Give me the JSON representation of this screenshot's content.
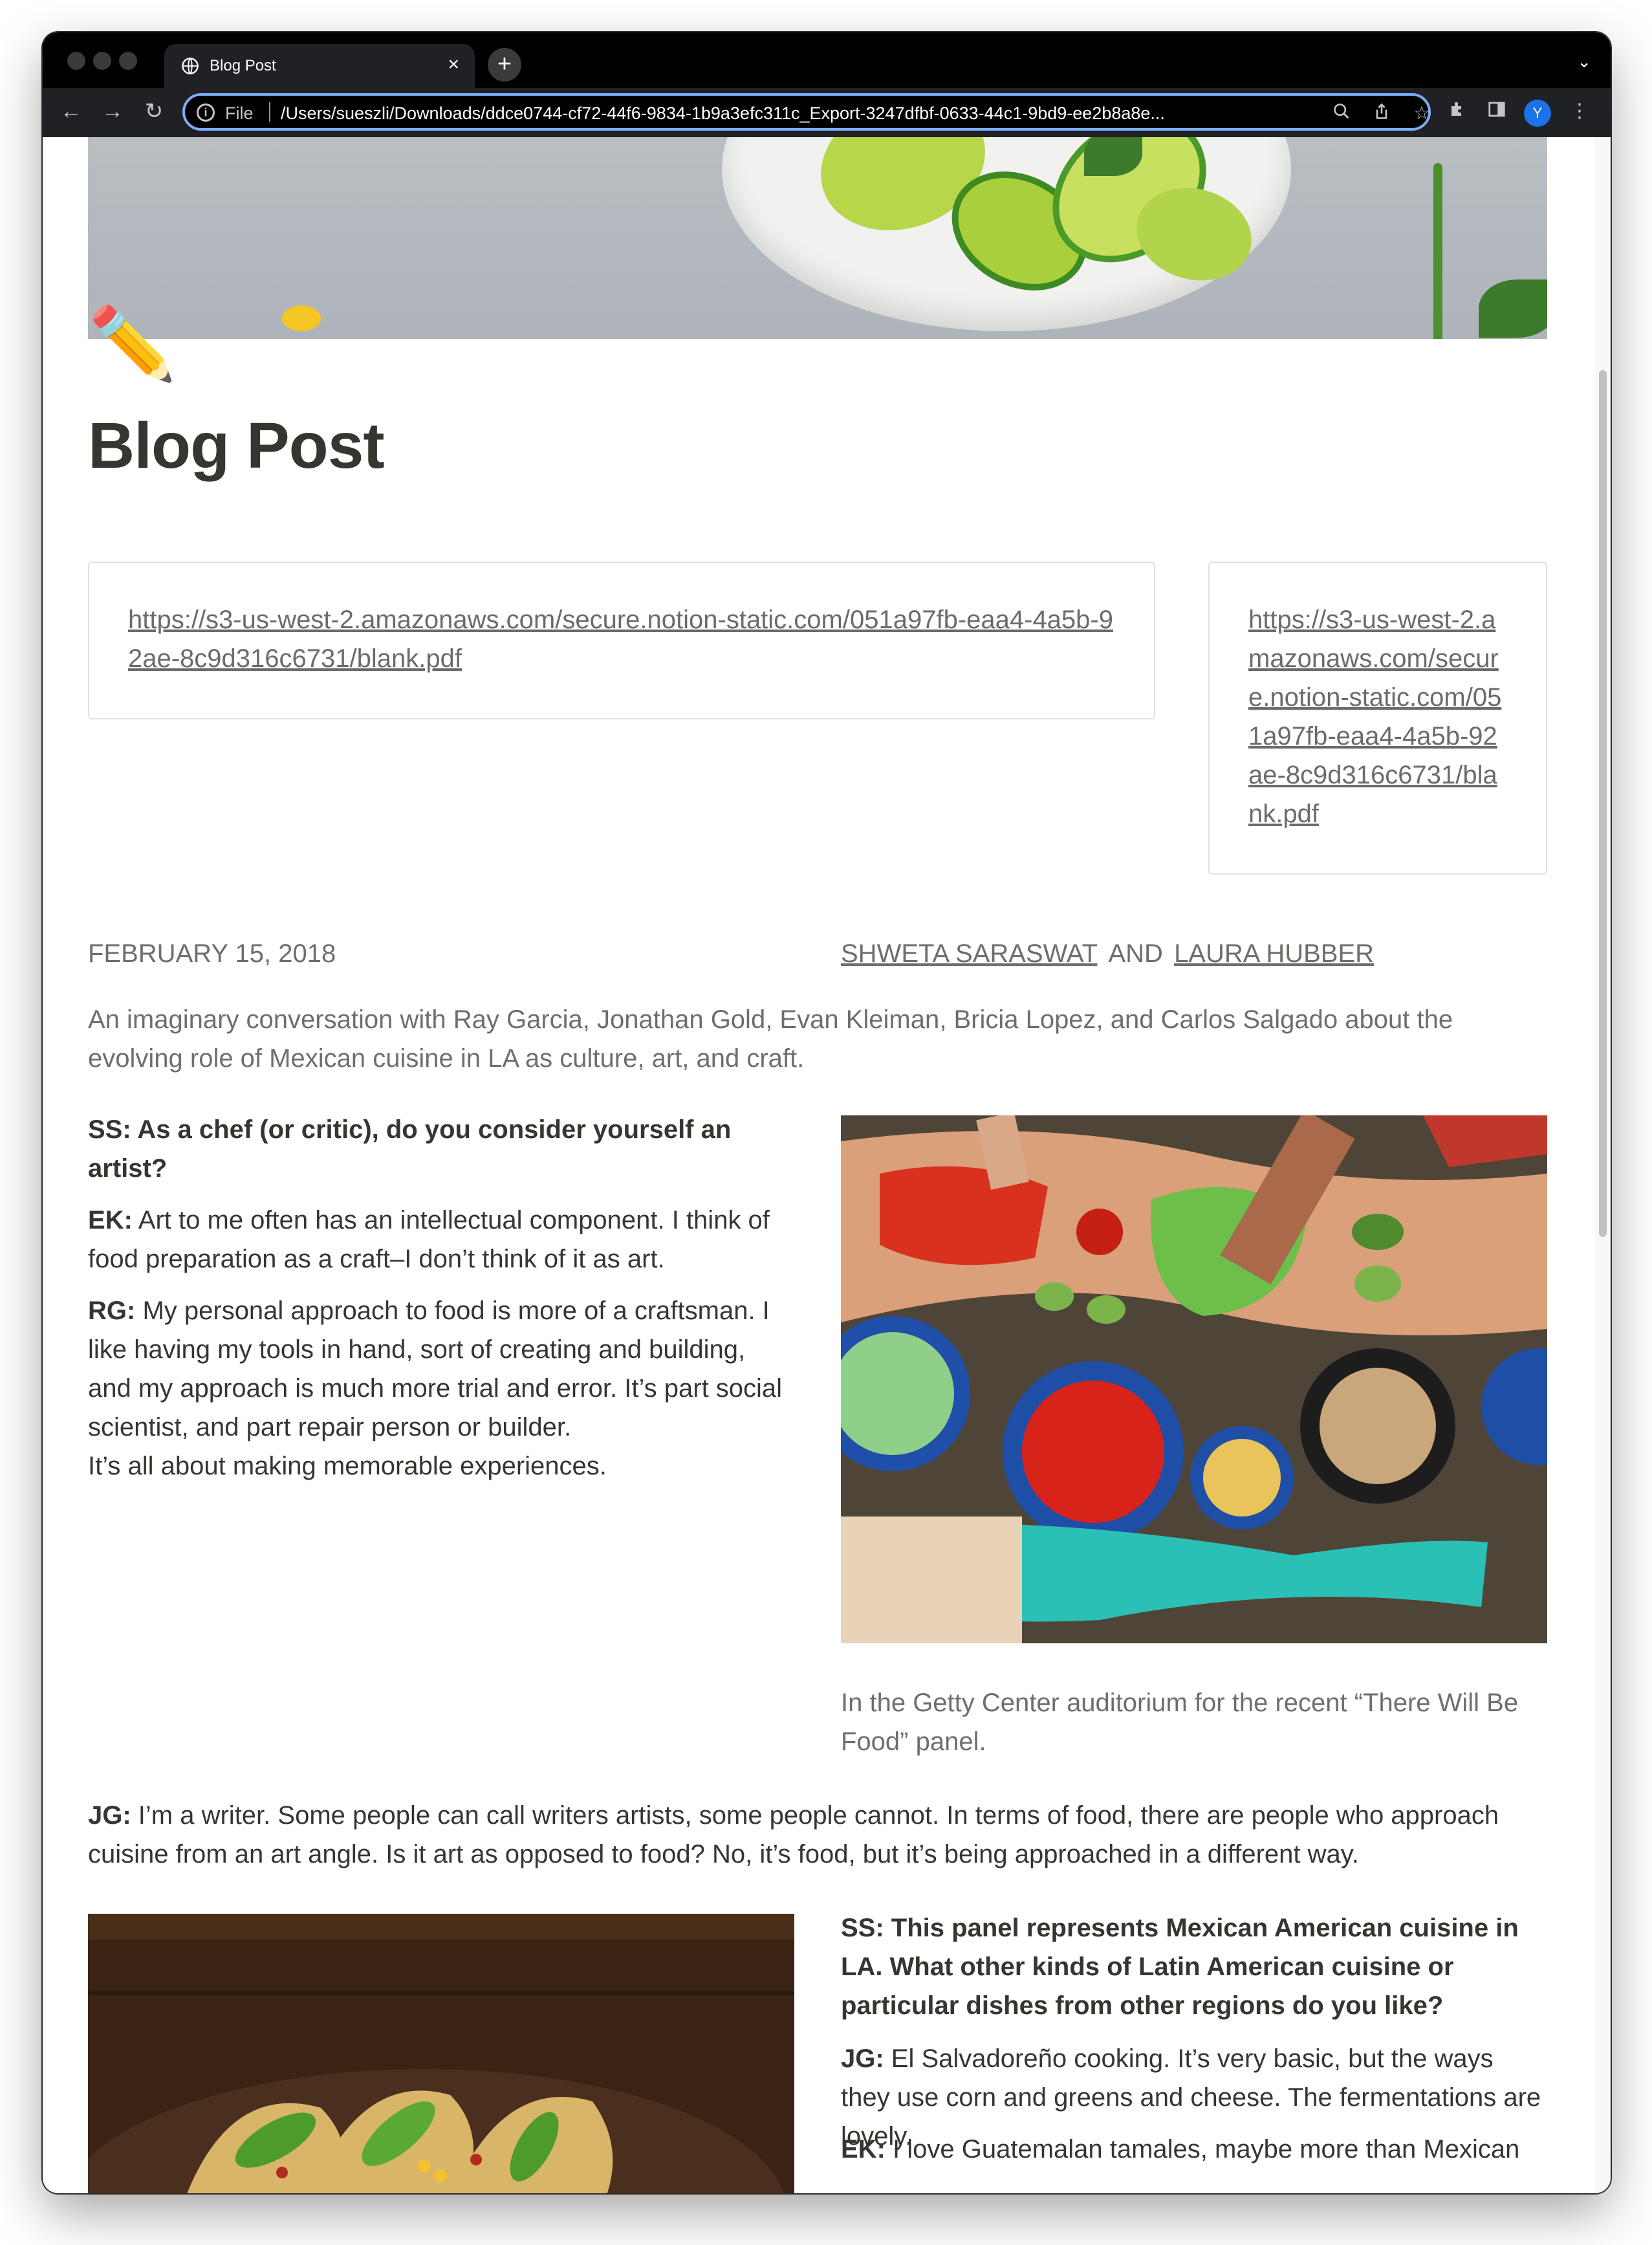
{
  "browser": {
    "tab_title": "Blog Post",
    "tab_close": "×",
    "new_tab": "+",
    "tab_menu": "⌄",
    "file_label": "File",
    "url": "/Users/sueszli/Downloads/ddce0744-cf72-44f6-9834-1b9a3efc311c_Export-3247dfbf-0633-44c1-9bd9-ee2b8a8e...",
    "avatar_initial": "Y"
  },
  "page": {
    "icon": "✏️",
    "title": "Blog Post",
    "embed_wide_url": "https://s3-us-west-2.amazonaws.com/secure.notion-static.com/051a97fb-eaa4-4a5b-92ae-8c9d316c6731/blank.pdf",
    "embed_narrow_url": "https://s3-us-west-2.amazonaws.com/secure.notion-static.com/051a97fb-eaa4-4a5b-92ae-8c9d316c6731/blank.pdf",
    "date": "FEBRUARY 15, 2018",
    "author_1": "SHWETA SARASWAT",
    "author_join": "AND",
    "author_2": "LAURA HUBBER",
    "intro": "An imaginary conversation with Ray Garcia, Jonathan Gold, Evan Kleiman, Bricia Lopez, and Carlos Salgado about the evolving role of Mexican cuisine in LA as culture, art, and craft.",
    "q1": "SS: As a chef (or critic), do you consider yourself an artist?",
    "ek1_speaker": "EK:",
    "ek1_text": " Art to me often has an intellectual component. I think of food preparation as a craft–I don’t think of it as art.",
    "rg1_speaker": "RG:",
    "rg1_text": " My personal approach to food is more of a craftsman. I like having my tools in hand, sort of creating and building, and my approach is much more trial and error. It’s part social scientist, and part repair person or builder.",
    "rg1_text_2": "It’s all about making memorable experiences.",
    "caption": "In the Getty Center auditorium for the recent “There Will Be Food” panel.",
    "jg1_speaker": "JG:",
    "jg1_text": " I’m a writer. Some people can call writers artists, some people cannot. In terms of food, there are people who approach cuisine from an art angle. Is it art as opposed to food? No, it’s food, but it’s being approached in a different way.",
    "q2": "SS: This panel represents Mexican American cuisine in LA. What other kinds of Latin American cuisine or particular dishes from other regions do you like?",
    "jg2_speaker": "JG:",
    "jg2_text": " El Salvadoreño cooking. It’s very basic, but the ways they use corn and greens and cheese. The fermentations are lovely.",
    "ek2_speaker": "EK:",
    "ek2_text": " I love Guatemalan tamales, maybe more than Mexican"
  }
}
